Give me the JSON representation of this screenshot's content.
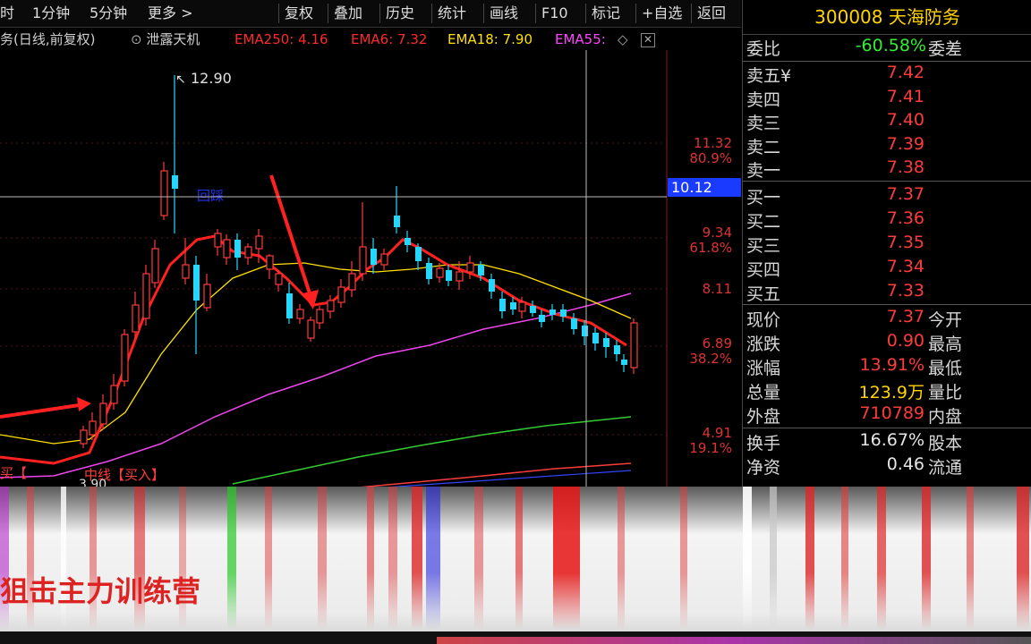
{
  "toolbar": {
    "items": [
      "时",
      "1分钟",
      "5分钟",
      "更多 >"
    ],
    "buttons": [
      "复权",
      "叠加",
      "历史",
      "统计",
      "画线",
      "F10",
      "标记",
      "+自选",
      "返回"
    ]
  },
  "legend": {
    "prefix": "务(日线,前复权)",
    "indicator": "泄露天机",
    "ema250": "EMA250: 4.16",
    "ema6": "EMA6: 7.32",
    "ema18": "EMA18: 7.90",
    "ema55": "EMA55:",
    "colors": {
      "ema250": "#ff2a2a",
      "ema6": "#ff2a2a",
      "ema18": "#ffe000",
      "ema55": "#ff44ff"
    }
  },
  "chart": {
    "high_label": "12.90",
    "crosshair_price": "10.12",
    "ticks_price": [
      "11.32",
      "9.34",
      "8.11",
      "6.89",
      "4.91"
    ],
    "ticks_pct": [
      "80.9%",
      "61.8%",
      "38.2%",
      "19.1%"
    ],
    "bottom_labels": {
      "left": "买【",
      "mid": "中线【买入】",
      "low": "3.90"
    },
    "annotation": "回踩"
  },
  "panel": {
    "code": "300008",
    "name": "天海防务",
    "weibi": {
      "label": "委比",
      "value": "-60.58%",
      "label2": "委差"
    },
    "asks": [
      {
        "label": "卖五",
        "mark": "¥",
        "price": "7.42"
      },
      {
        "label": "卖四",
        "price": "7.41"
      },
      {
        "label": "卖三",
        "price": "7.40"
      },
      {
        "label": "卖二",
        "price": "7.39"
      },
      {
        "label": "卖一",
        "price": "7.38"
      }
    ],
    "bids": [
      {
        "label": "买一",
        "price": "7.37"
      },
      {
        "label": "买二",
        "price": "7.36"
      },
      {
        "label": "买三",
        "price": "7.35"
      },
      {
        "label": "买四",
        "price": "7.34"
      },
      {
        "label": "买五",
        "price": "7.33"
      }
    ],
    "stats": [
      {
        "label": "现价",
        "value": "7.37",
        "label2": "今开",
        "color": "#ff3b3b"
      },
      {
        "label": "涨跌",
        "value": "0.90",
        "label2": "最高",
        "color": "#ff3b3b"
      },
      {
        "label": "涨幅",
        "value": "13.91%",
        "label2": "最低",
        "color": "#ff3b3b"
      },
      {
        "label": "总量",
        "value": "123.9万",
        "label2": "量比",
        "color": "#ffd400"
      },
      {
        "label": "外盘",
        "value": "710789",
        "label2": "内盘",
        "color": "#ff3b3b"
      }
    ],
    "stats2": [
      {
        "label": "换手",
        "value": "16.67%",
        "label2": "股本",
        "color": "#e6e6e6"
      },
      {
        "label": "净资",
        "value": "0.46",
        "label2": "流通",
        "color": "#e6e6e6"
      }
    ]
  },
  "overlay": {
    "brand": "狙击主力训练营"
  },
  "colors": {
    "up": "#ff3b3b",
    "down": "#22d8ff",
    "grid": "#6b1b1b",
    "gold": "#ffd400"
  }
}
